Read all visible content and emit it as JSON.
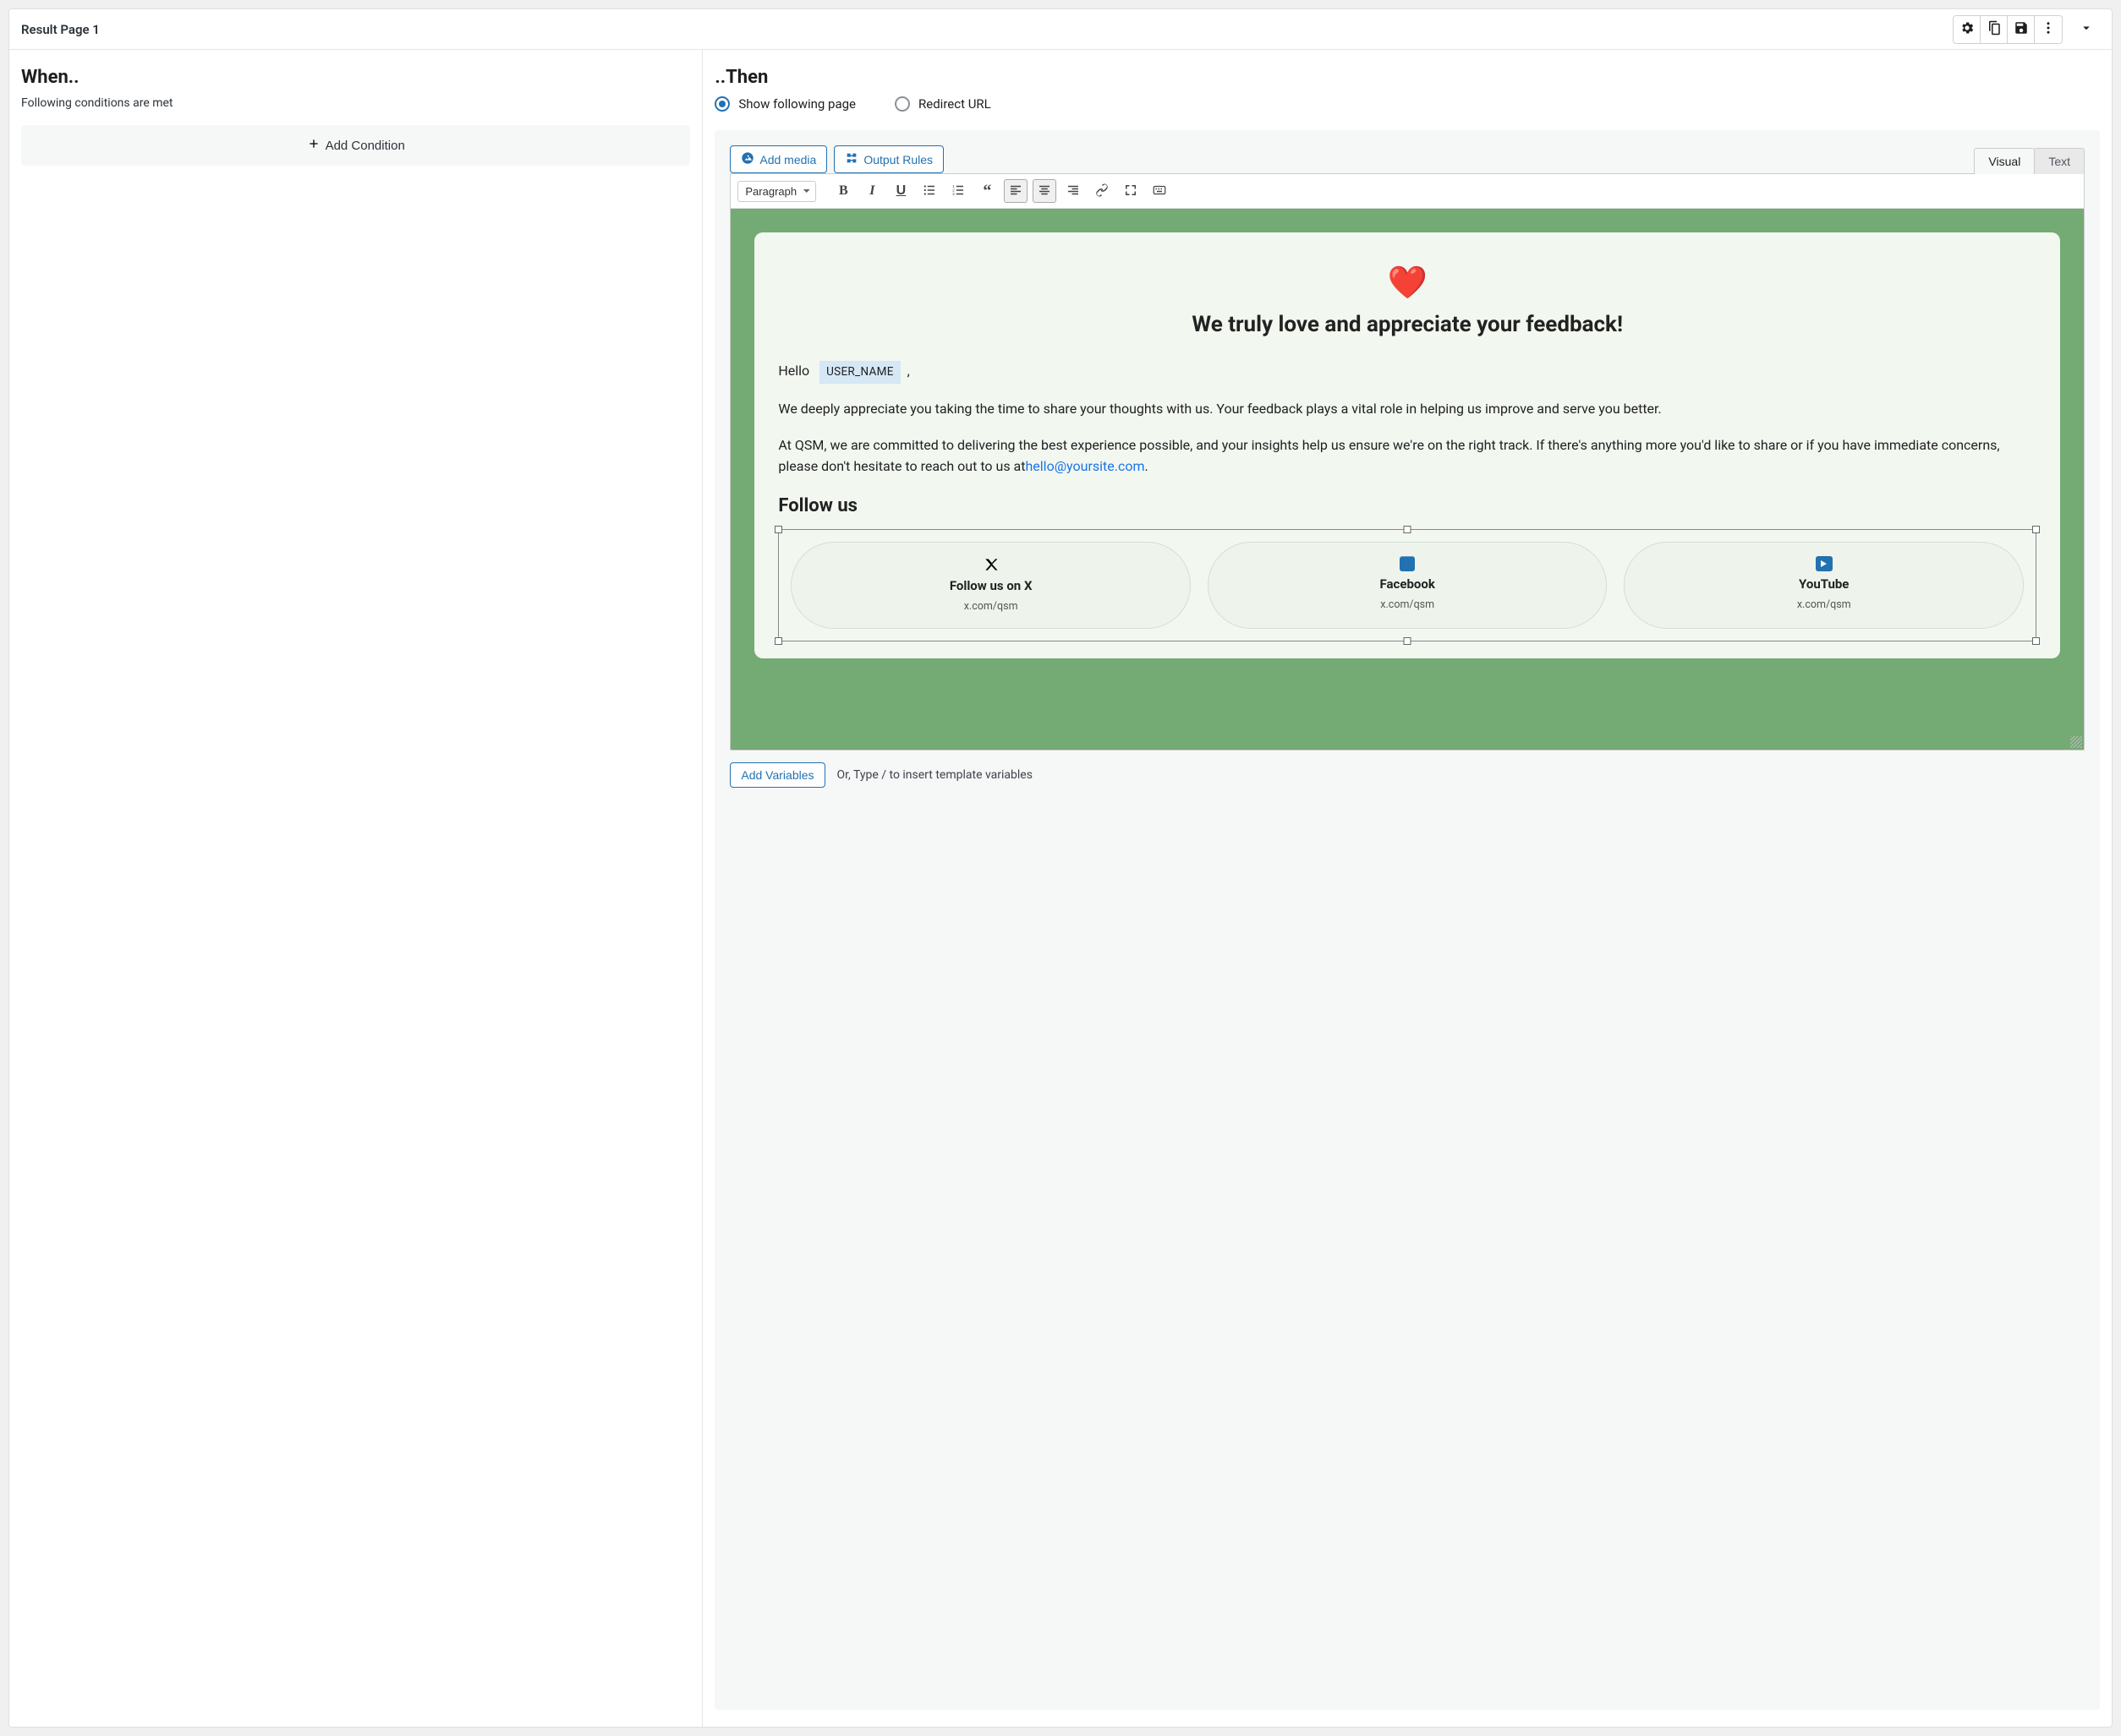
{
  "header": {
    "title": "Result Page 1"
  },
  "left": {
    "heading": "When..",
    "hint": "Following conditions are met",
    "add_condition_label": "Add Condition"
  },
  "right": {
    "heading": "..Then",
    "radios": {
      "show_page": "Show following page",
      "redirect": "Redirect URL"
    },
    "buttons": {
      "add_media": "Add media",
      "output_rules": "Output Rules"
    },
    "tabs": {
      "visual": "Visual",
      "text": "Text"
    },
    "format_select": "Paragraph"
  },
  "content": {
    "heart": "❤️",
    "heading": "We truly love and appreciate your feedback!",
    "greeting_prefix": "Hello",
    "user_var": "USER_NAME",
    "greeting_suffix": ",",
    "p1": "We deeply appreciate you taking the time to share your thoughts with us. Your feedback plays a vital role in helping us improve and serve you better.",
    "p2_pre": "At QSM, we are committed to delivering the best experience possible, and your insights help us ensure we're on the right track. If there's anything more you'd like to share or if you have immediate concerns, please don't hesitate to reach out to us at",
    "email": "hello@yoursite.com",
    "p2_post": ".",
    "follow_heading": "Follow us",
    "social": [
      {
        "label": "Follow us on X",
        "sub": "x.com/qsm"
      },
      {
        "label": "Facebook",
        "sub": "x.com/qsm"
      },
      {
        "label": "YouTube",
        "sub": "x.com/qsm"
      }
    ]
  },
  "footer": {
    "add_variables": "Add Variables",
    "hint": "Or, Type / to insert template variables"
  },
  "icons": {
    "toolbar": [
      "bold",
      "italic",
      "underline",
      "bullet-list",
      "ordered-list",
      "quote",
      "align-left",
      "align-center",
      "align-right",
      "link",
      "expand",
      "keyboard"
    ]
  }
}
